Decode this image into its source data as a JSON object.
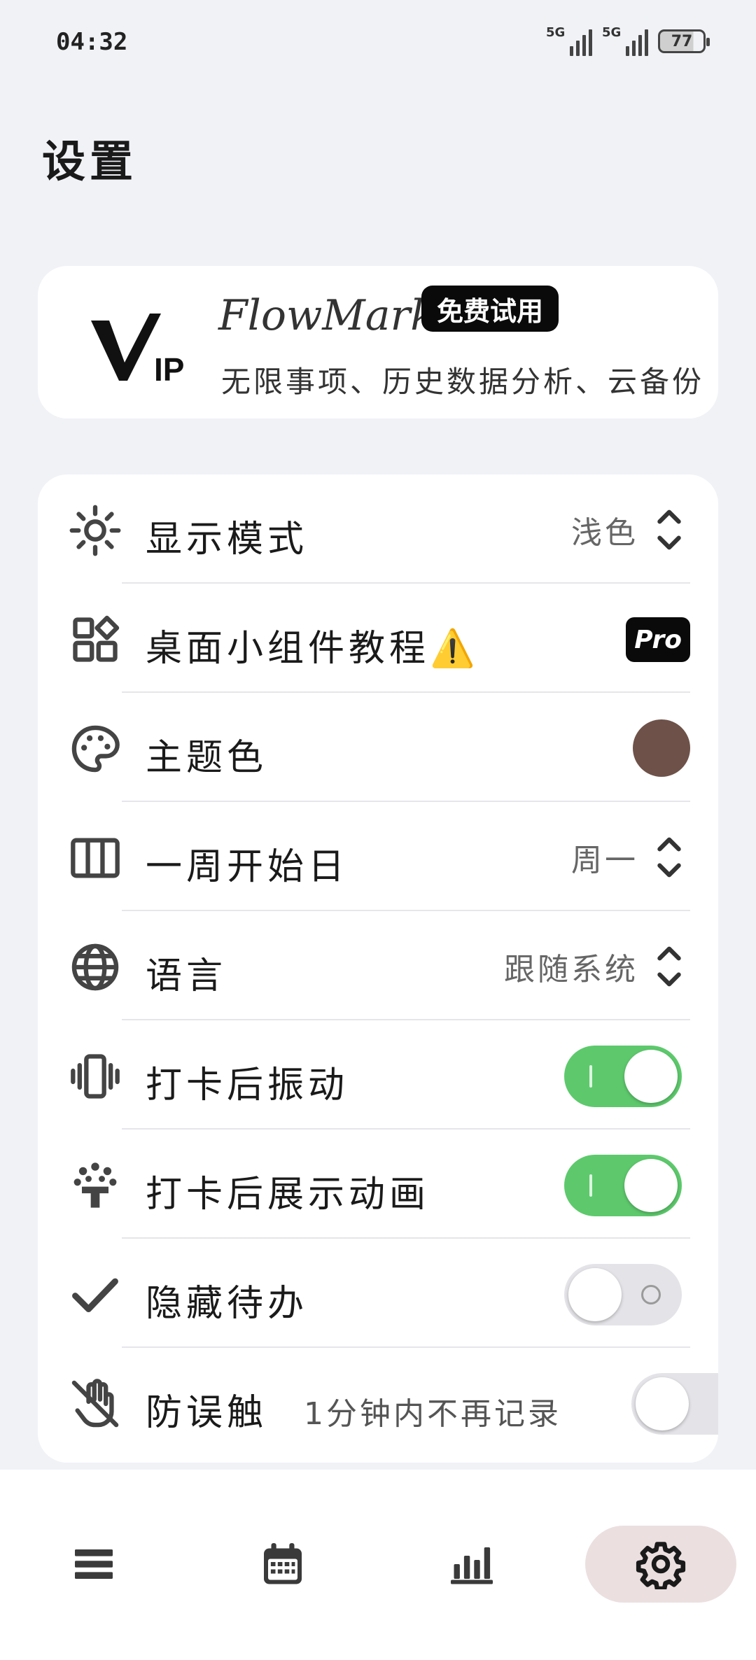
{
  "status_bar": {
    "time": "04:32",
    "network_1": "5G",
    "network_2": "5G",
    "battery": "77"
  },
  "page": {
    "title": "设置"
  },
  "vip_card": {
    "logo_text": "VIP",
    "app_name": "FlowMark",
    "badge": "免费试用",
    "description": "无限事项、历史数据分析、云备份"
  },
  "settings": {
    "display_mode": {
      "label": "显示模式",
      "value": "浅色",
      "icon": "brightness-icon"
    },
    "widget_tutorial": {
      "label": "桌面小组件教程⚠️",
      "badge": "Pro",
      "icon": "widgets-icon"
    },
    "theme_color": {
      "label": "主题色",
      "color": "#6e5148",
      "icon": "palette-icon"
    },
    "week_start": {
      "label": "一周开始日",
      "value": "周一",
      "icon": "columns-icon"
    },
    "language": {
      "label": "语言",
      "value": "跟随系统",
      "icon": "globe-icon"
    },
    "vibrate_after_checkin": {
      "label": "打卡后振动",
      "enabled": true,
      "icon": "vibration-icon"
    },
    "animation_after_checkin": {
      "label": "打卡后展示动画",
      "enabled": true,
      "icon": "celebration-icon"
    },
    "hide_todo": {
      "label": "隐藏待办",
      "enabled": false,
      "icon": "check-icon"
    },
    "anti_mistouch": {
      "label": "防误触",
      "sublabel": "1分钟内不再记录",
      "enabled": false,
      "icon": "do-not-touch-icon"
    }
  },
  "bottom_nav": {
    "items": [
      {
        "name": "list",
        "icon": "list-icon",
        "active": false
      },
      {
        "name": "calendar",
        "icon": "calendar-icon",
        "active": false
      },
      {
        "name": "stats",
        "icon": "bar-chart-icon",
        "active": false
      },
      {
        "name": "settings",
        "icon": "gear-icon",
        "active": true
      }
    ]
  },
  "colors": {
    "background": "#f1f2f6",
    "toggle_on": "#5dc96c",
    "nav_active": "#ebdfe0",
    "theme": "#6e5148"
  }
}
